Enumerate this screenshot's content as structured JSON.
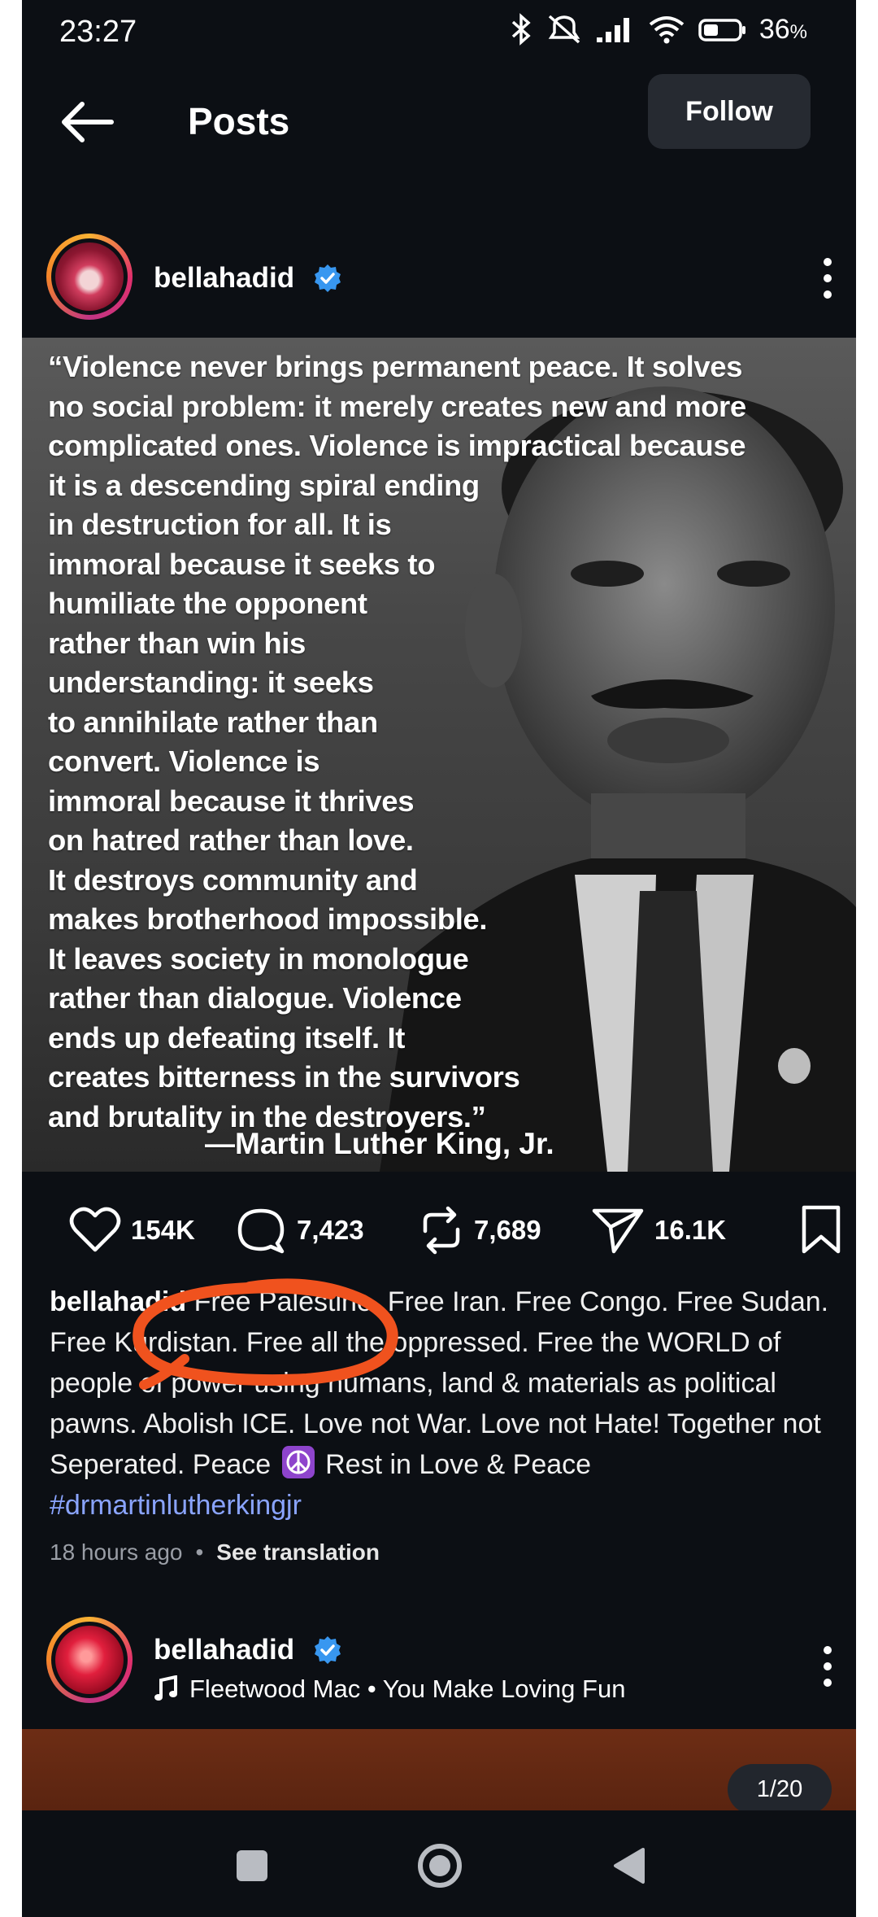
{
  "status_bar": {
    "time": "23:27",
    "battery_percent": "36",
    "battery_suffix": "%",
    "icons": [
      "bluetooth-icon",
      "mute-icon",
      "signal-icon",
      "wifi-icon",
      "battery-icon"
    ]
  },
  "header": {
    "title": "Posts",
    "follow_label": "Follow"
  },
  "post": {
    "username": "bellahadid",
    "verified": true,
    "image_quote": "“Violence never brings permanent peace. It solves\nno social problem: it merely creates new and more\ncomplicated ones. Violence is impractical because\nit is a descending spiral ending\nin destruction for all. It is\nimmoral because it seeks to\nhumiliate the opponent\nrather than win his\nunderstanding: it seeks\nto annihilate rather than\nconvert. Violence is\nimmoral because it thrives\non hatred rather than love.\nIt destroys community and\nmakes brotherhood impossible.\nIt leaves society in monologue\nrather than dialogue. Violence\nends up defeating itself. It\ncreates bitterness in the survivors\nand brutality in the destroyers.”",
    "image_attribution": "—Martin Luther King, Jr.",
    "likes": "154K",
    "comments": "7,423",
    "reposts": "7,689",
    "shares": "16.1K",
    "caption_user": "bellahadid",
    "caption_text": "Free Palestine. Free Iran. Free Congo. Free Sudan. Free Kurdistan. Free all the oppressed. Free the WORLD of people of power using humans, land & materials as political pawns. Abolish ICE. Love not War. Love not Hate! Together not Seperated. Peace",
    "caption_tail": "Rest in Love & Peace",
    "hashtag": "#drmartinlutherkingjr",
    "timestamp": "18 hours ago",
    "separator": "•",
    "see_translation": "See translation",
    "annotation_color": "#f0521e"
  },
  "next_post": {
    "username": "bellahadid",
    "verified": true,
    "music": "Fleetwood Mac • You Make Loving Fun",
    "counter": "1/20"
  },
  "colors": {
    "background": "#0c0f14",
    "verified_blue": "#3897f0",
    "hashtag": "#8aa4ff",
    "button_bg": "#262a31"
  }
}
